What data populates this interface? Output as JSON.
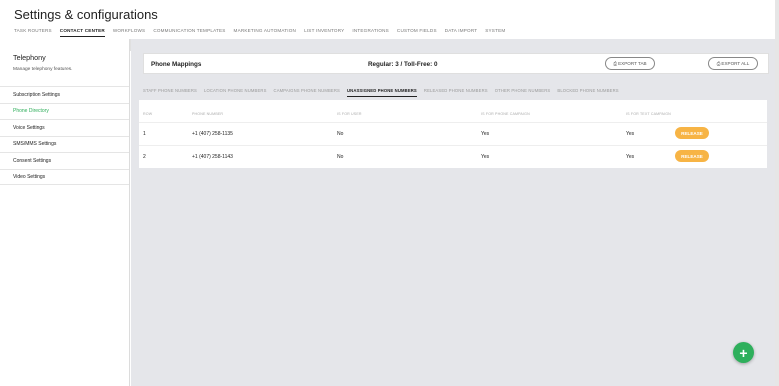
{
  "header": {
    "title": "Settings & configurations",
    "nav": [
      "TASK ROUTERS",
      "CONTACT CENTER",
      "WORKFLOWS",
      "COMMUNICATION TEMPLATES",
      "MARKETING AUTOMATION",
      "LIST INVENTORY",
      "INTEGRATIONS",
      "CUSTOM FIELDS",
      "DATA IMPORT",
      "SYSTEM"
    ],
    "active_nav": "CONTACT CENTER"
  },
  "sidebar": {
    "title": "Telephony",
    "subtitle": "Manage telephony features.",
    "items": [
      "Subscription Settings",
      "Phone Directory",
      "Voice Settings",
      "SMS/MMS Settings",
      "Consent Settings",
      "Video Settings"
    ],
    "active_item": "Phone Directory",
    "collapse_icon": "chevron-left-icon"
  },
  "card": {
    "title": "Phone Mappings",
    "count": "Regular: 3 / Toll-Free: 0",
    "export_tab": "EXPORT TAB",
    "export_all": "EXPORT ALL",
    "export_icon": "export-icon"
  },
  "tabs": {
    "items": [
      "STAFF PHONE NUMBERS",
      "LOCATION PHONE NUMBERS",
      "CAMPAIGNS PHONE NUMBERS",
      "UNASSIGNED PHONE NUMBERS",
      "RELEASED PHONE NUMBERS",
      "OTHER PHONE NUMBERS",
      "BLOCKED PHONE NUMBERS"
    ],
    "active": "UNASSIGNED PHONE NUMBERS"
  },
  "table": {
    "columns": [
      "ROW",
      "PHONE NUMBER",
      "IS FOR USER",
      "IS FOR PHONE CAMPAIGN",
      "IS FOR TEXT CAMPAIGN"
    ],
    "rows": [
      {
        "row": "1",
        "phone": "+1 (407) 258-1135",
        "user": "No",
        "phone_campaign": "Yes",
        "text_campaign": "Yes",
        "action": "RELEASE"
      },
      {
        "row": "2",
        "phone": "+1 (407) 258-1143",
        "user": "No",
        "phone_campaign": "Yes",
        "text_campaign": "Yes",
        "action": "RELEASE"
      }
    ]
  },
  "fab": {
    "label": "+",
    "icon": "plus-icon"
  },
  "colors": {
    "accent_green": "#2eaf5c",
    "release_orange": "#f7b445",
    "main_bg": "#e5e6ea"
  }
}
